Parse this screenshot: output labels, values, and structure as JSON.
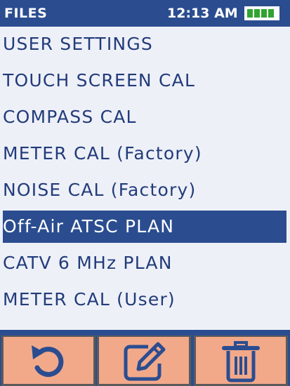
{
  "status_bar": {
    "title": "FILES",
    "time": "12:13 AM",
    "battery_icon": "battery-full-icon"
  },
  "menu": {
    "items": [
      {
        "label": "USER SETTINGS"
      },
      {
        "label": "TOUCH SCREEN CAL"
      },
      {
        "label": "COMPASS CAL"
      },
      {
        "label": "METER CAL (Factory)"
      },
      {
        "label": "NOISE CAL (Factory)"
      },
      {
        "label": "Off-Air ATSC PLAN",
        "selected": true
      },
      {
        "label": "CATV 6 MHz PLAN"
      },
      {
        "label": "METER CAL (User)"
      }
    ]
  },
  "toolbar": {
    "buttons": [
      {
        "icon": "undo-icon"
      },
      {
        "icon": "edit-icon"
      },
      {
        "icon": "trash-icon"
      }
    ]
  },
  "colors": {
    "header_bg": "#2b4d90",
    "list_bg": "#eef0f8",
    "text": "#223c7a",
    "selected_bg": "#2b4d90",
    "button_bg": "#f2a98a",
    "icon_color": "#2b4d90",
    "battery_fill": "#2fa42f"
  }
}
